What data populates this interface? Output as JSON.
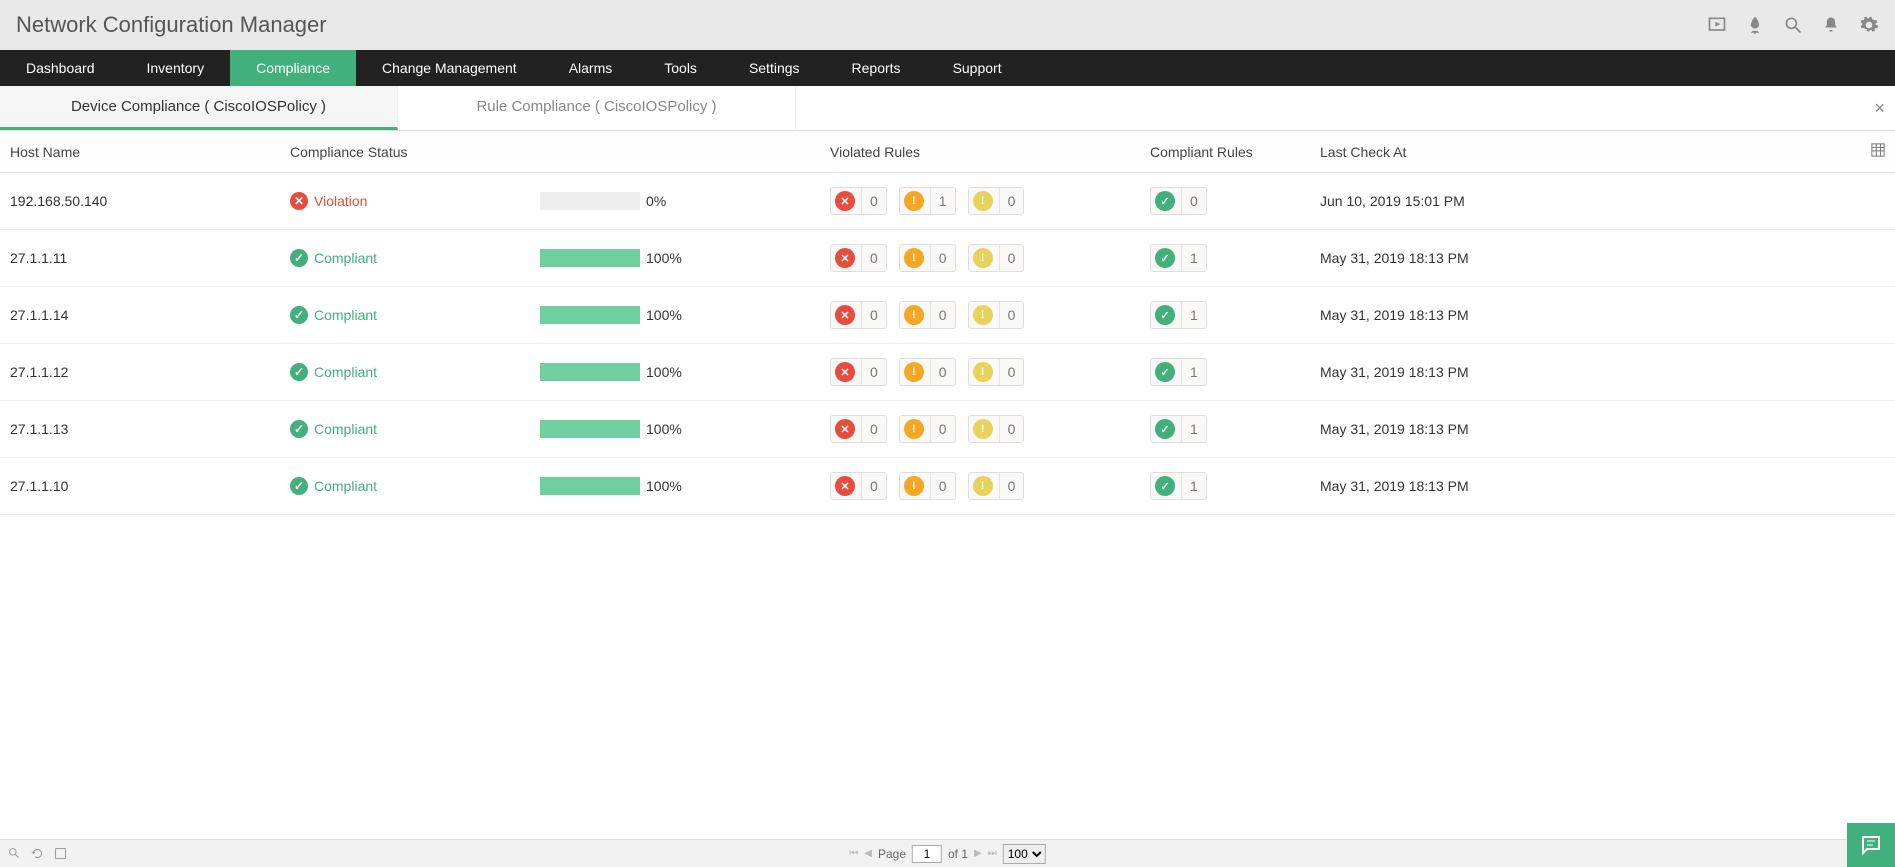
{
  "app": {
    "title": "Network Configuration Manager"
  },
  "nav": {
    "items": [
      "Dashboard",
      "Inventory",
      "Compliance",
      "Change Management",
      "Alarms",
      "Tools",
      "Settings",
      "Reports",
      "Support"
    ],
    "active": 2
  },
  "subtabs": {
    "items": [
      {
        "label": "Device Compliance ( CiscoIOSPolicy )"
      },
      {
        "label": "Rule Compliance ( CiscoIOSPolicy )"
      }
    ],
    "active": 0
  },
  "columns": {
    "host": "Host Name",
    "status": "Compliance Status",
    "violated": "Violated Rules",
    "compliant": "Compliant Rules",
    "time": "Last Check At"
  },
  "status_labels": {
    "violation": "Violation",
    "compliant": "Compliant"
  },
  "rows": [
    {
      "host": "192.168.50.140",
      "status": "violation",
      "pct": 0,
      "pct_label": "0%",
      "v_err": 0,
      "v_warn": 1,
      "v_low": 0,
      "c_ok": 0,
      "time": "Jun 10, 2019 15:01 PM"
    },
    {
      "host": "27.1.1.11",
      "status": "compliant",
      "pct": 100,
      "pct_label": "100%",
      "v_err": 0,
      "v_warn": 0,
      "v_low": 0,
      "c_ok": 1,
      "time": "May 31, 2019 18:13 PM"
    },
    {
      "host": "27.1.1.14",
      "status": "compliant",
      "pct": 100,
      "pct_label": "100%",
      "v_err": 0,
      "v_warn": 0,
      "v_low": 0,
      "c_ok": 1,
      "time": "May 31, 2019 18:13 PM"
    },
    {
      "host": "27.1.1.12",
      "status": "compliant",
      "pct": 100,
      "pct_label": "100%",
      "v_err": 0,
      "v_warn": 0,
      "v_low": 0,
      "c_ok": 1,
      "time": "May 31, 2019 18:13 PM"
    },
    {
      "host": "27.1.1.13",
      "status": "compliant",
      "pct": 100,
      "pct_label": "100%",
      "v_err": 0,
      "v_warn": 0,
      "v_low": 0,
      "c_ok": 1,
      "time": "May 31, 2019 18:13 PM"
    },
    {
      "host": "27.1.1.10",
      "status": "compliant",
      "pct": 100,
      "pct_label": "100%",
      "v_err": 0,
      "v_warn": 0,
      "v_low": 0,
      "c_ok": 1,
      "time": "May 31, 2019 18:13 PM"
    }
  ],
  "pager": {
    "label_page": "Page",
    "current": "1",
    "of": "of 1",
    "pagesize": "100"
  }
}
